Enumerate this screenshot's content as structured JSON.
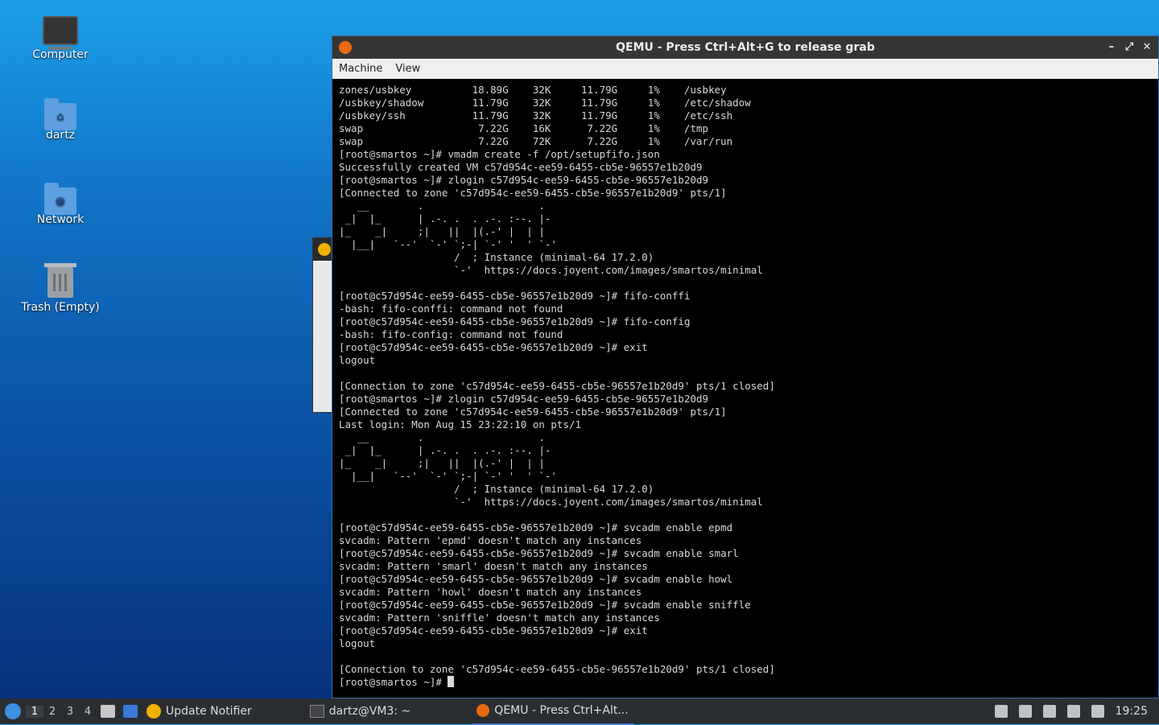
{
  "desktop": {
    "icons": [
      {
        "label": "Computer"
      },
      {
        "label": "dartz"
      },
      {
        "label": "Network"
      },
      {
        "label": "Trash (Empty)"
      }
    ]
  },
  "qemu": {
    "title": "QEMU - Press Ctrl+Alt+G to release grab",
    "controls": {
      "minimize": "–",
      "maximize": "⤢",
      "close": "✕"
    },
    "menu": [
      "Machine",
      "View"
    ],
    "terminal_text": "zones/usbkey          18.89G    32K     11.79G     1%    /usbkey\n/usbkey/shadow        11.79G    32K     11.79G     1%    /etc/shadow\n/usbkey/ssh           11.79G    32K     11.79G     1%    /etc/ssh\nswap                   7.22G    16K      7.22G     1%    /tmp\nswap                   7.22G    72K      7.22G     1%    /var/run\n[root@smartos ~]# vmadm create -f /opt/setupfifo.json\nSuccessfully created VM c57d954c-ee59-6455-cb5e-96557e1b20d9\n[root@smartos ~]# zlogin c57d954c-ee59-6455-cb5e-96557e1b20d9\n[Connected to zone 'c57d954c-ee59-6455-cb5e-96557e1b20d9' pts/1]\n   __        .                   .\n _|  |_      | .-. .  . .-. :--. |-\n|_    _|     ;|   ||  |(.-' |  | |\n  |__|   `--'  `-' `;-| `-' '  ' `-'\n                   /  ; Instance (minimal-64 17.2.0)\n                   `-'  https://docs.joyent.com/images/smartos/minimal\n\n[root@c57d954c-ee59-6455-cb5e-96557e1b20d9 ~]# fifo-conffi\n-bash: fifo-conffi: command not found\n[root@c57d954c-ee59-6455-cb5e-96557e1b20d9 ~]# fifo-config\n-bash: fifo-config: command not found\n[root@c57d954c-ee59-6455-cb5e-96557e1b20d9 ~]# exit\nlogout\n\n[Connection to zone 'c57d954c-ee59-6455-cb5e-96557e1b20d9' pts/1 closed]\n[root@smartos ~]# zlogin c57d954c-ee59-6455-cb5e-96557e1b20d9\n[Connected to zone 'c57d954c-ee59-6455-cb5e-96557e1b20d9' pts/1]\nLast login: Mon Aug 15 23:22:10 on pts/1\n   __        .                   .\n _|  |_      | .-. .  . .-. :--. |-\n|_    _|     ;|   ||  |(.-' |  | |\n  |__|   `--'  `-' `;-| `-' '  ' `-'\n                   /  ; Instance (minimal-64 17.2.0)\n                   `-'  https://docs.joyent.com/images/smartos/minimal\n\n[root@c57d954c-ee59-6455-cb5e-96557e1b20d9 ~]# svcadm enable epmd\nsvcadm: Pattern 'epmd' doesn't match any instances\n[root@c57d954c-ee59-6455-cb5e-96557e1b20d9 ~]# svcadm enable smarl\nsvcadm: Pattern 'smarl' doesn't match any instances\n[root@c57d954c-ee59-6455-cb5e-96557e1b20d9 ~]# svcadm enable howl\nsvcadm: Pattern 'howl' doesn't match any instances\n[root@c57d954c-ee59-6455-cb5e-96557e1b20d9 ~]# svcadm enable sniffle\nsvcadm: Pattern 'sniffle' doesn't match any instances\n[root@c57d954c-ee59-6455-cb5e-96557e1b20d9 ~]# exit\nlogout\n\n[Connection to zone 'c57d954c-ee59-6455-cb5e-96557e1b20d9' pts/1 closed]\n",
    "prompt": "[root@smartos ~]# "
  },
  "taskbar": {
    "workspaces": [
      "1",
      "2",
      "3",
      "4"
    ],
    "tasks": [
      {
        "label": "Update Notifier"
      },
      {
        "label": "dartz@VM3: ~"
      },
      {
        "label": "QEMU - Press Ctrl+Alt..."
      }
    ],
    "clock": "19:25"
  },
  "colors": {
    "accent": "#3b7dd8",
    "terminal_bg": "#000000",
    "terminal_fg": "#d8d8d8"
  }
}
